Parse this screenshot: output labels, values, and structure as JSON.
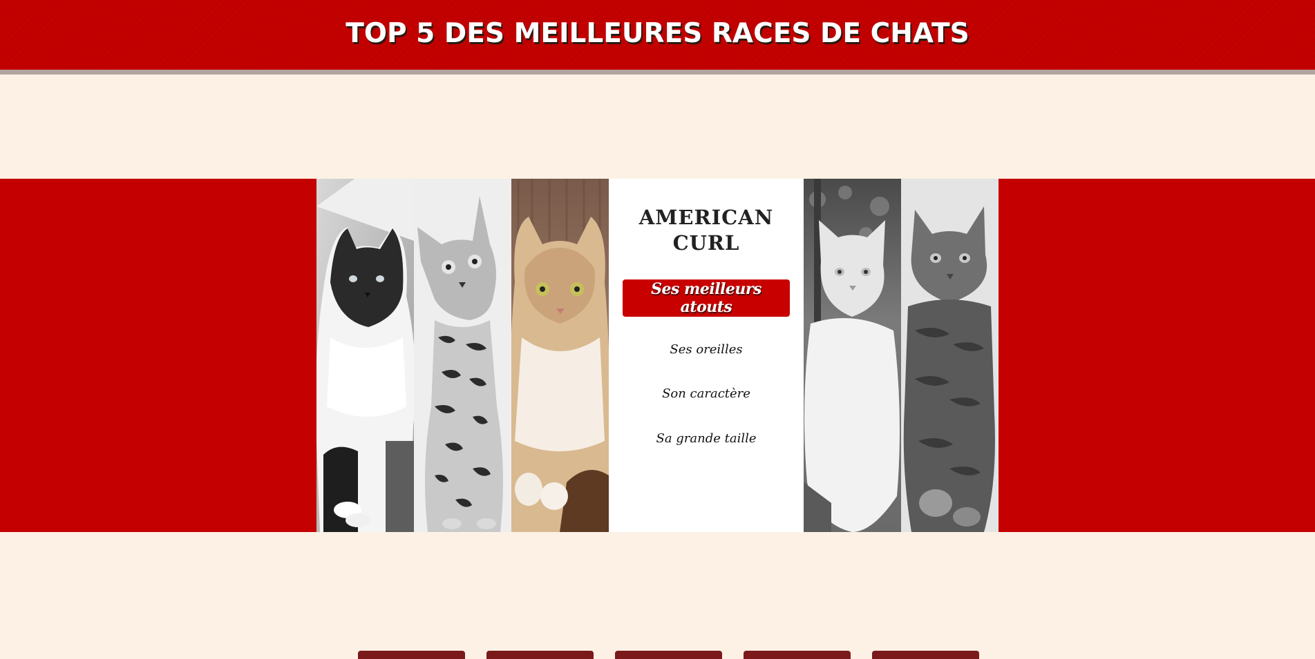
{
  "header": {
    "title": "TOP 5 DES MEILLEURES RACES DE CHATS"
  },
  "gallery": {
    "panels": [
      {
        "icon": "ragdoll-cat-photo",
        "tone": "grayscale"
      },
      {
        "icon": "bengal-cat-photo",
        "tone": "grayscale"
      },
      {
        "icon": "american-curl-cat-photo",
        "tone": "color"
      },
      {
        "icon": "norwegian-forest-cat-photo",
        "tone": "grayscale"
      },
      {
        "icon": "maine-coon-cat-photo",
        "tone": "grayscale"
      }
    ],
    "feature": {
      "breed_line1": "AMERICAN",
      "breed_line2": "CURL",
      "atouts_button": "Ses meilleurs atouts",
      "atouts": [
        "Ses oreilles",
        "Son caractère",
        "Sa grande taille"
      ]
    }
  },
  "colors": {
    "brand_red": "#c40000",
    "page_background": "#fdf1e6",
    "divider": "#b3a3a0"
  }
}
